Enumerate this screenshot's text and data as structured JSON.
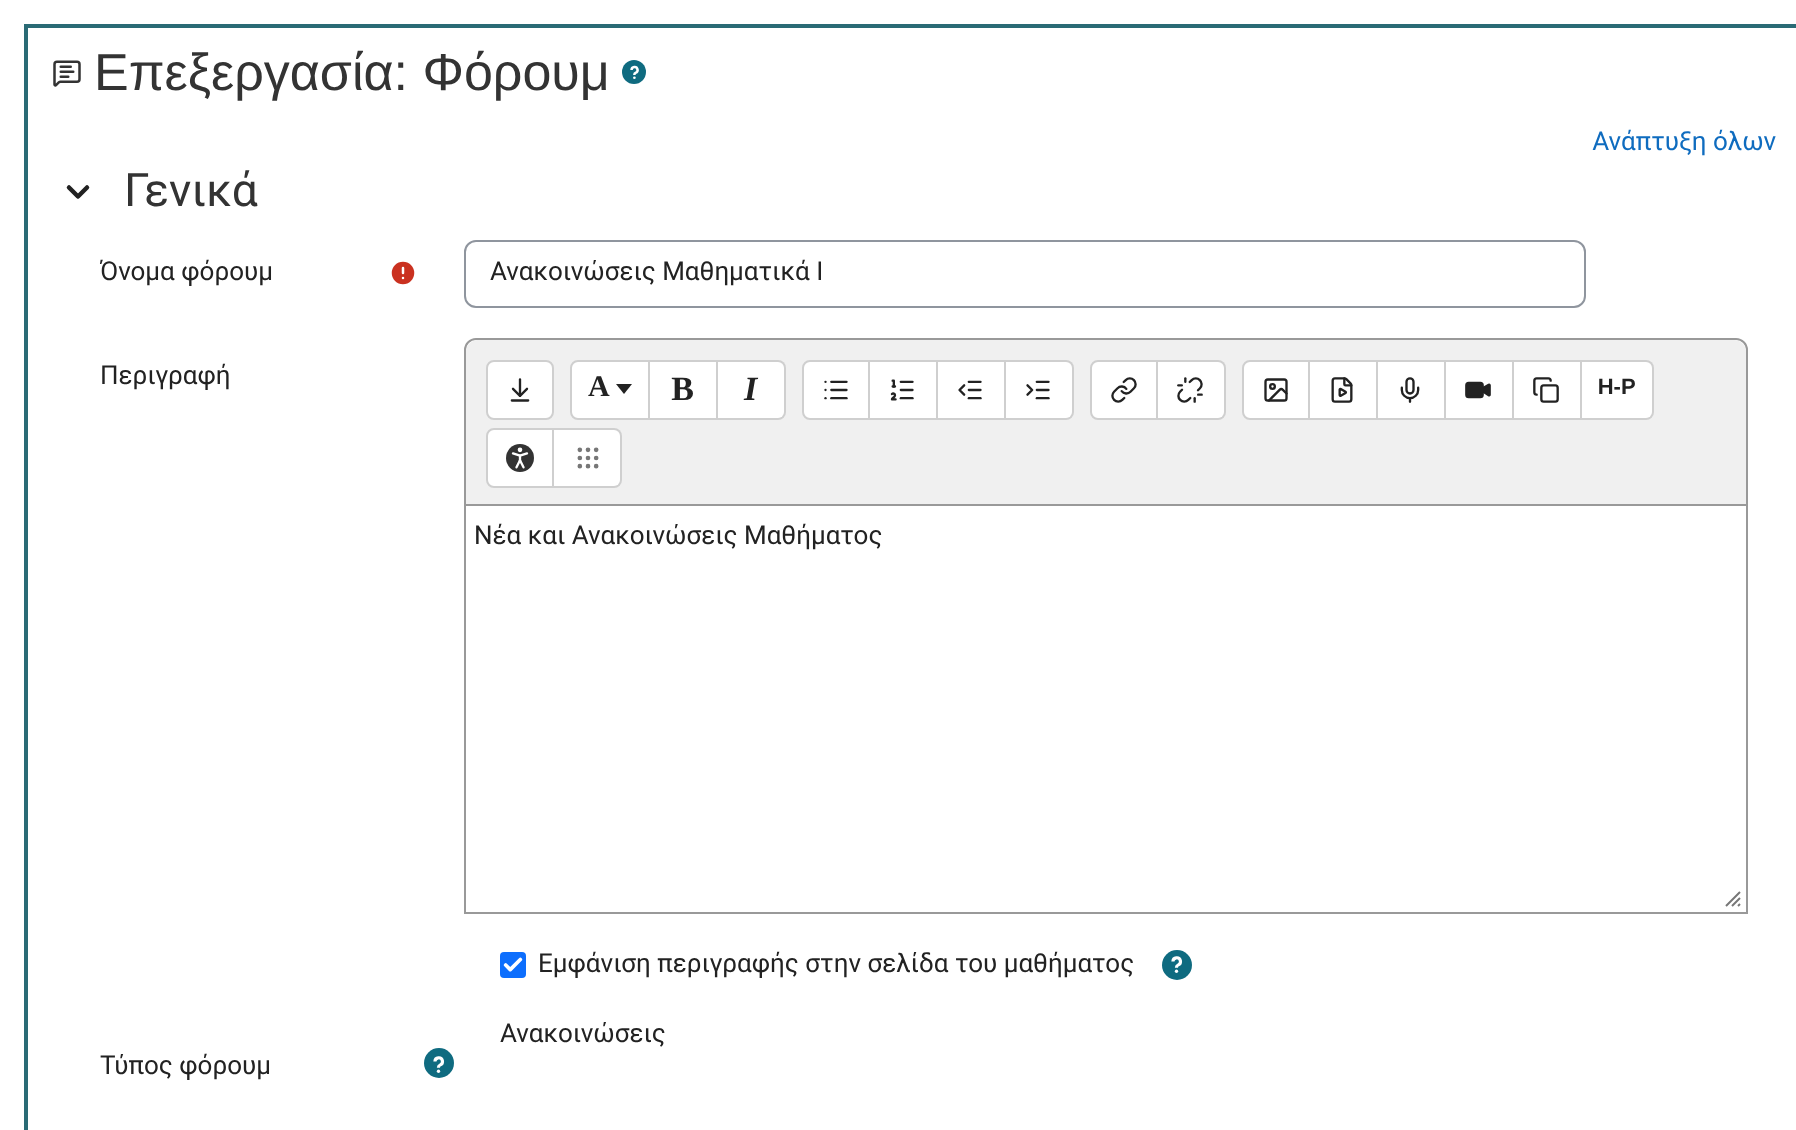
{
  "page": {
    "title": "Επεξεργασία: Φόρουμ",
    "expand_all": "Ανάπτυξη όλων"
  },
  "section": {
    "title": "Γενικά",
    "expanded": true
  },
  "name_field": {
    "label": "Όνομα φόρουμ",
    "required": true,
    "value": "Ανακοινώσεις Μαθηματικά Ι"
  },
  "description": {
    "label": "Περιγραφή",
    "toolbar_labels": {
      "font": "A",
      "bold": "B",
      "italic": "I",
      "h5p": "H-P"
    },
    "content": "Νέα και Ανακοινώσεις Μαθήματος"
  },
  "show_description": {
    "label": "Εμφάνιση περιγραφής στην σελίδα του μαθήματος",
    "checked": true
  },
  "forum_type": {
    "label": "Τύπος φόρουμ",
    "value": "Ανακοινώσεις"
  }
}
